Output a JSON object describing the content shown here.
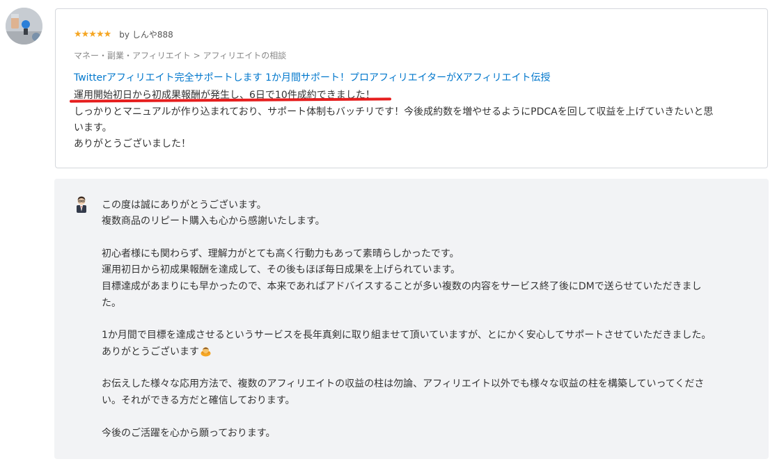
{
  "review": {
    "rating": 5,
    "stars": "★★★★★",
    "reviewer": "by しんや888",
    "category": "マネー・副業・アフィリエイト > アフィリエイトの相談",
    "service_link": "Twitterアフィリエイト完全サポートします 1か月間サポート！プロアフィリエイターがXアフィリエイト伝授",
    "lines": [
      "運用開始初日から初成果報酬が発生し、6日で10件成約できました！",
      "しっかりとマニュアルが作り込まれており、サポート体制もバッチリです！今後成約数を増やせるようにPDCAを回して収益を上げていきたいと思",
      "います。",
      "ありがとうございました！"
    ]
  },
  "reply": {
    "lines": [
      "この度は誠にありがとうございます。",
      "複数商品のリピート購入も心から感謝いたします。",
      "初心者様にも関わらず、理解力がとても高く行動力もあって素晴らしかったです。",
      "運用初日から初成果報酬を達成して、その後もほぼ毎日成果を上げられています。",
      "目標達成があまりにも早かったので、本来であればアドバイスすることが多い複数の内容をサービス終了後にDMで送らせていただきまし",
      "た。",
      "1か月間で目標を達成させるというサービスを長年真剣に取り組ませて頂いていますが、とにかく安心してサポートさせていただきました。",
      "ありがとうございます",
      "お伝えした様々な応用方法で、複数のアフィリエイトの収益の柱は勿論、アフィリエイト以外でも様々な収益の柱を構築していってくださ",
      "い。それができる方だと確信しております。",
      "今後のご活躍を心から願っております。"
    ],
    "emoji": "bowing-person-emoji"
  },
  "colors": {
    "link": "#0077cc",
    "star": "#f5a623",
    "highlight_underline": "#e61e1e",
    "reply_background": "#f2f3f5"
  }
}
